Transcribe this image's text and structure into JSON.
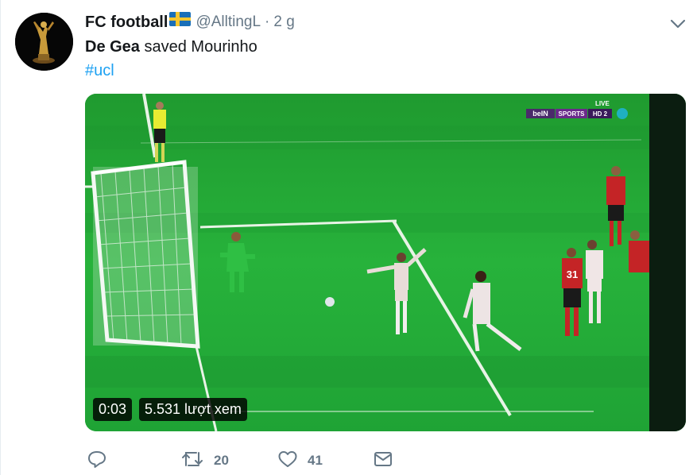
{
  "tweet": {
    "author": {
      "display_name": "FC football",
      "flag_icon": "sweden-flag-icon",
      "handle": "@AlltingL",
      "separator": "·",
      "time": "2 g"
    },
    "text_bold": "De Gea",
    "text_rest": " saved Mourinho",
    "hashtag": "#ucl",
    "media": {
      "duration": "0:03",
      "views": "5.531 lượt xem",
      "scoreboard": {
        "live": "LIVE",
        "channel": "beIN",
        "sports": "SPORTS",
        "hd": "HD 2",
        "jersey_number": "31"
      }
    },
    "actions": {
      "reply_icon": "reply-icon",
      "retweet_icon": "retweet-icon",
      "retweet_count": "20",
      "like_icon": "heart-icon",
      "like_count": "41",
      "dm_icon": "envelope-icon"
    }
  },
  "colors": {
    "link": "#1da1f2",
    "muted": "#657786",
    "text": "#14171a",
    "pitch": "#23a83a"
  }
}
